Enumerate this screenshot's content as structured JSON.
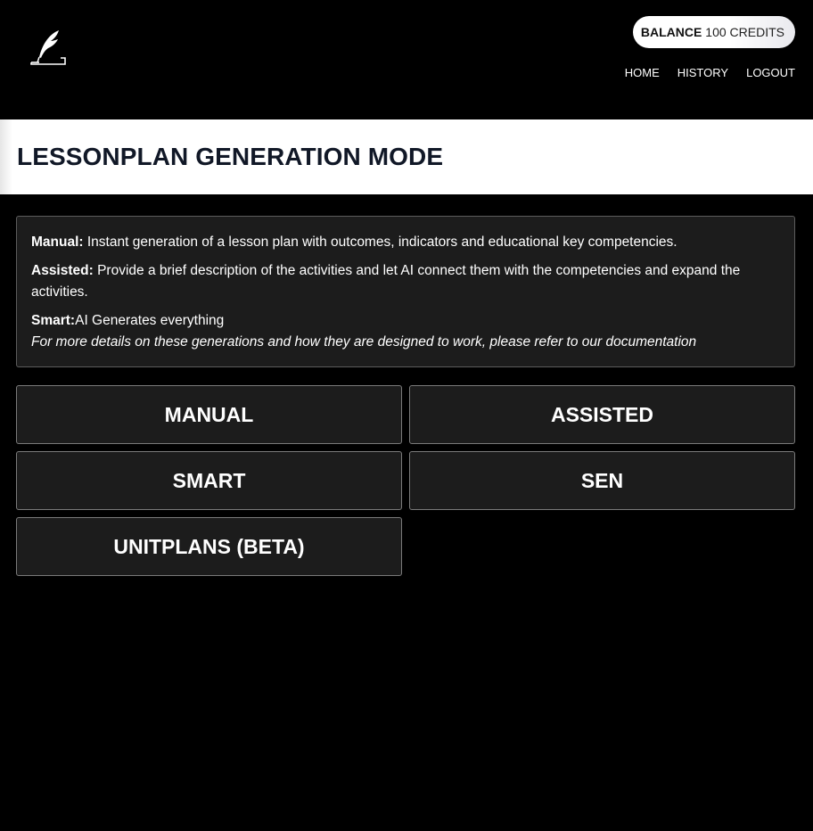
{
  "header": {
    "logo_icon": "quill-pen-icon",
    "balance": {
      "label": "BALANCE",
      "amount": "100 CREDITS"
    },
    "nav": {
      "home": "HOME",
      "history": "HISTORY",
      "logout": "LOGOUT"
    }
  },
  "page": {
    "title": "LESSONPLAN GENERATION MODE"
  },
  "info": {
    "manual_label": "Manual:",
    "manual_text": " Instant generation of a lesson plan with outcomes, indicators and educational key competencies.",
    "assisted_label": "Assisted:",
    "assisted_text": " Provide a brief description of the activities and let AI connect them with the competencies and expand the activities.",
    "smart_label": "Smart:",
    "smart_text": "AI Generates everything",
    "note": "For more details on these generations and how they are designed to work, please refer to our documentation"
  },
  "modes": {
    "manual": "MANUAL",
    "assisted": "ASSISTED",
    "smart": "SMART",
    "sen": "SEN",
    "unitplans": "UNITPLANS (BETA)"
  },
  "colors": {
    "background": "#000000",
    "panel": "#1c1c1c",
    "title_band": "#ffffff",
    "title_text": "#111827"
  }
}
